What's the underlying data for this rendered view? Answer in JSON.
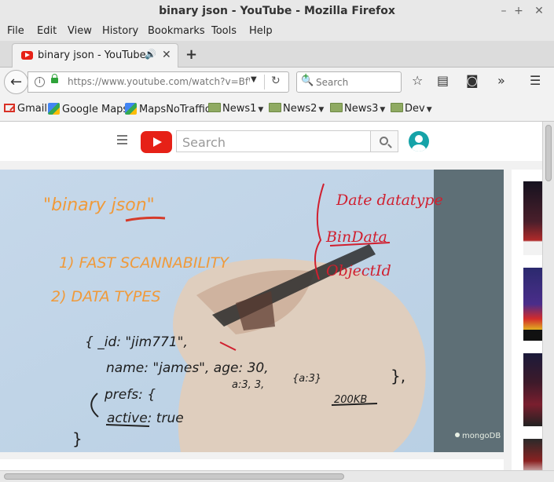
{
  "window": {
    "title": "binary json - YouTube - Mozilla Firefox",
    "controls": [
      "–",
      "+",
      "✕"
    ]
  },
  "menu": [
    "File",
    "Edit",
    "View",
    "History",
    "Bookmarks",
    "Tools",
    "Help"
  ],
  "tab": {
    "title": "binary json - YouTube",
    "new_tab_symbol": "+"
  },
  "nav": {
    "url": "https://www.youtube.com/watch?v=BfWn",
    "search_placeholder": "Search"
  },
  "bookmarks": {
    "gmail": "Gmail",
    "google_maps": "Google Maps",
    "maps_no_traffic": "MapsNoTraffic",
    "folders": [
      "News1",
      "News2",
      "News3",
      "Dev"
    ]
  },
  "youtube": {
    "search_placeholder": "Search",
    "brand_color": "#e62117"
  },
  "video": {
    "title_text": "\"binary json\"",
    "list_items": [
      "1) FAST SCANNABILITY",
      "2) DATA TYPES"
    ],
    "types": [
      "Date datatype",
      "BinData",
      "ObjectId"
    ],
    "code_lines": [
      "{ _id: \"jim771\",",
      "name: \"james\", age: 30,",
      "prefs: {",
      "active: true",
      "}"
    ],
    "sub_text": [
      "a:3, 3,",
      "{a:3}",
      "200KB"
    ],
    "watermark": "mongoDB"
  }
}
